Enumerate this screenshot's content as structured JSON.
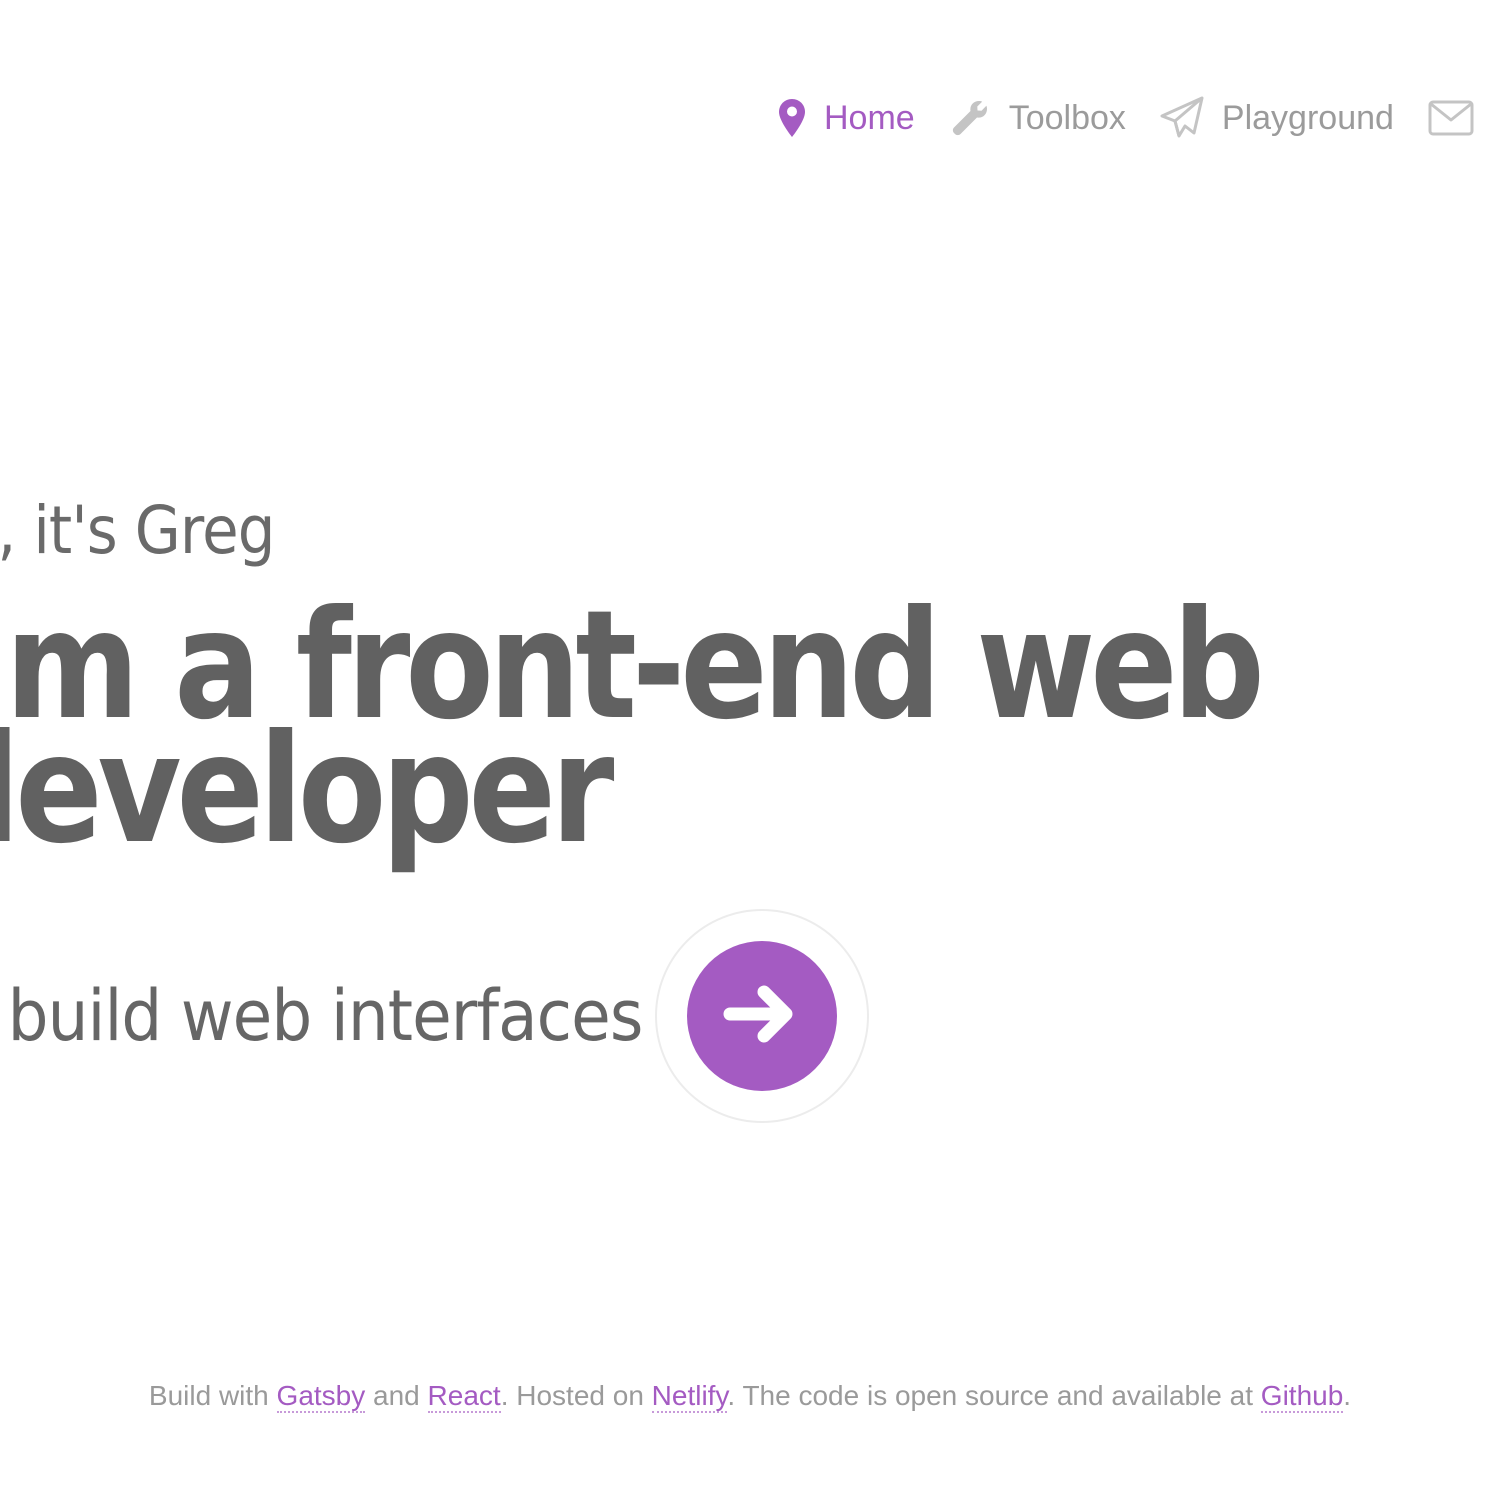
{
  "nav": {
    "items": [
      {
        "label": "Home",
        "icon": "map-pin-icon",
        "active": true
      },
      {
        "label": "Toolbox",
        "icon": "wrench-icon",
        "active": false
      },
      {
        "label": "Playground",
        "icon": "paper-plane-icon",
        "active": false
      },
      {
        "label": "",
        "icon": "envelope-icon",
        "active": false
      }
    ]
  },
  "hero": {
    "greeting": "Hi, it's Greg",
    "headline_line1": "I'm a front-end web",
    "headline_line2": "developer",
    "tagline": "I build web interfaces",
    "cta_icon": "arrow-right-icon"
  },
  "footer": {
    "text_1": "Build with ",
    "link_gatsby": "Gatsby",
    "text_2": " and ",
    "link_react": "React",
    "text_3": ". Hosted on ",
    "link_netlify": "Netlify",
    "text_4": ". The code is open source and available at ",
    "link_github": "Github",
    "text_5": "."
  },
  "colors": {
    "accent": "#a45bc2",
    "nav_text": "#9b9b9b",
    "heading_text": "#616161",
    "footer_text": "#9a9a9a",
    "background": "#ffffff"
  }
}
